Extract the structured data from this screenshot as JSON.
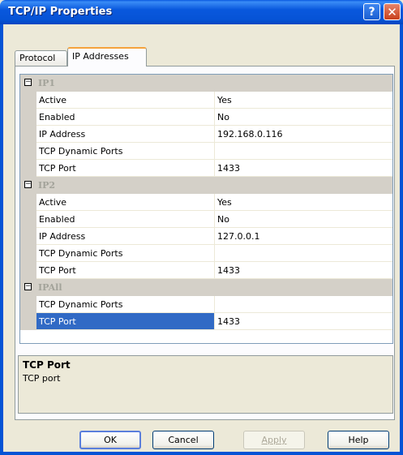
{
  "window": {
    "title": "TCP/IP Properties",
    "help_glyph": "?",
    "close_glyph": "✕"
  },
  "tabs": [
    {
      "label": "Protocol"
    },
    {
      "label": "IP Addresses"
    }
  ],
  "grid": {
    "categories": [
      {
        "label": "IP1",
        "rows": [
          {
            "name": "Active",
            "value": "Yes"
          },
          {
            "name": "Enabled",
            "value": "No"
          },
          {
            "name": "IP Address",
            "value": "192.168.0.116"
          },
          {
            "name": "TCP Dynamic Ports",
            "value": ""
          },
          {
            "name": "TCP Port",
            "value": "1433"
          }
        ]
      },
      {
        "label": "IP2",
        "rows": [
          {
            "name": "Active",
            "value": "Yes"
          },
          {
            "name": "Enabled",
            "value": "No"
          },
          {
            "name": "IP Address",
            "value": "127.0.0.1"
          },
          {
            "name": "TCP Dynamic Ports",
            "value": ""
          },
          {
            "name": "TCP Port",
            "value": "1433"
          }
        ]
      },
      {
        "label": "IPAll",
        "rows": [
          {
            "name": "TCP Dynamic Ports",
            "value": ""
          },
          {
            "name": "TCP Port",
            "value": "1433"
          }
        ]
      }
    ],
    "collapse_glyph": "−"
  },
  "description": {
    "title": "TCP Port",
    "text": "TCP port"
  },
  "buttons": {
    "ok": "OK",
    "cancel": "Cancel",
    "apply": "Apply",
    "help": "Help"
  },
  "colors": {
    "selection": "#316ac5",
    "titlebar": "#0653d6",
    "tab_accent": "#f5a33d"
  }
}
